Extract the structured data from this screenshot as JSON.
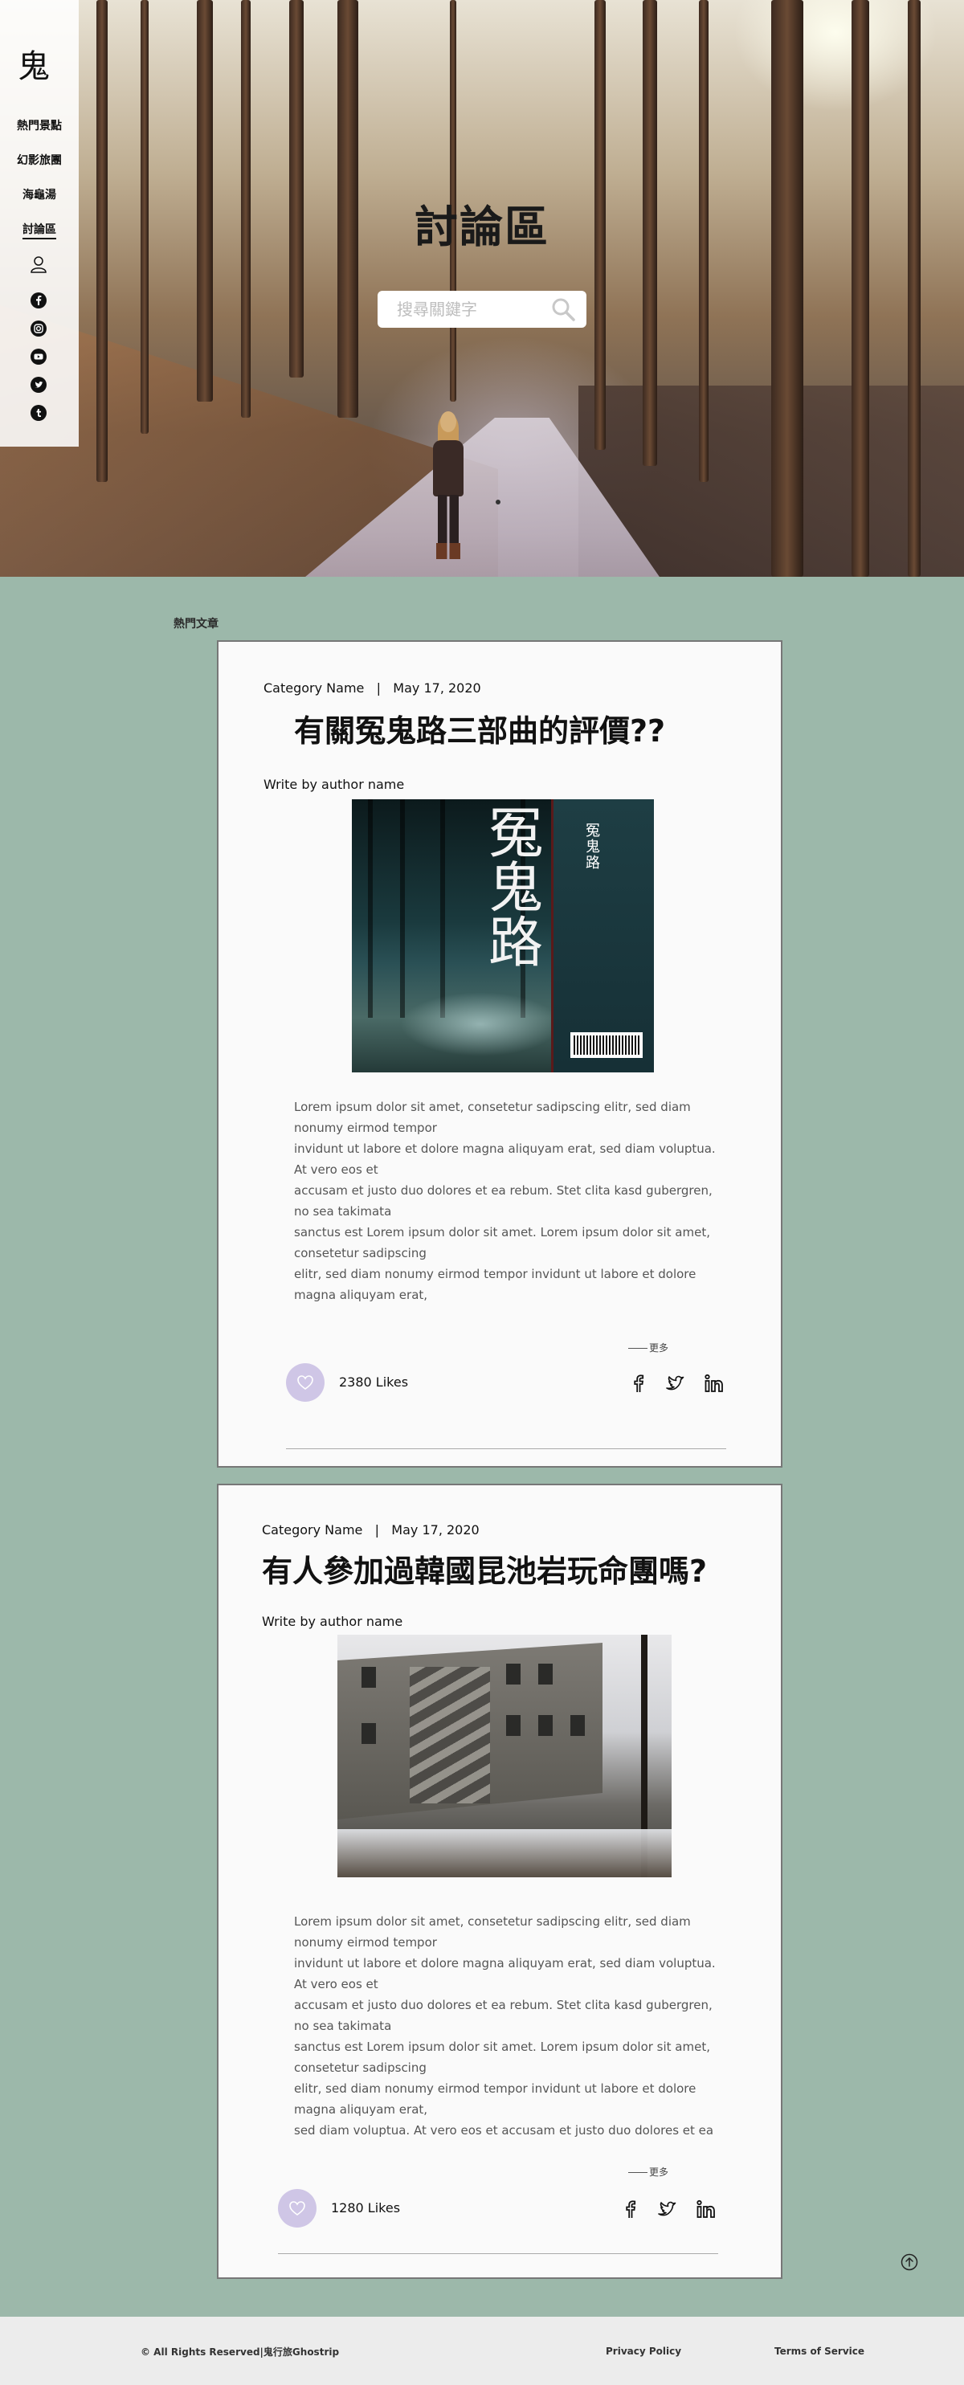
{
  "sidebar": {
    "logo": "鬼",
    "nav": [
      {
        "label": "熱門景點"
      },
      {
        "label": "幻影旅團"
      },
      {
        "label": "海龜湯"
      },
      {
        "label": "討論區",
        "active": true
      }
    ],
    "icons": [
      "user-icon",
      "facebook-icon",
      "instagram-icon",
      "youtube-icon",
      "twitter-icon",
      "tumblr-icon"
    ]
  },
  "hero": {
    "title": "討論區",
    "search_placeholder": "搜尋關鍵字"
  },
  "main": {
    "section_label": "熱門文章",
    "posts": [
      {
        "category": "Category Name",
        "separator": "|",
        "date": "May 17, 2020",
        "title": "有關冤鬼路三部曲的評價??",
        "author": "Write by author name",
        "body": "Lorem ipsum dolor sit amet, consetetur sadipscing elitr, sed diam nonumy eirmod tempor\ninvidunt ut labore et dolore magna aliquyam erat, sed diam voluptua. At vero eos et\naccusam et justo duo dolores et ea rebum. Stet clita kasd gubergren, no sea takimata\nsanctus est Lorem ipsum dolor sit amet. Lorem ipsum dolor sit amet, consetetur sadipscing\nelitr, sed diam nonumy eirmod tempor invidunt ut labore et dolore magna aliquyam erat,",
        "more": "更多",
        "likes": "2380 Likes"
      },
      {
        "category": "Category Name",
        "separator": "|",
        "date": "May 17, 2020",
        "title": "有人參加過韓國昆池岩玩命團嗎?",
        "author": "Write by author name",
        "body": "Lorem ipsum dolor sit amet, consetetur sadipscing elitr, sed diam nonumy eirmod tempor\ninvidunt ut labore et dolore magna aliquyam erat, sed diam voluptua. At vero eos et\naccusam et justo duo dolores et ea rebum. Stet clita kasd gubergren, no sea takimata\nsanctus est Lorem ipsum dolor sit amet. Lorem ipsum dolor sit amet, consetetur sadipscing\nelitr, sed diam nonumy eirmod tempor invidunt ut labore et dolore magna aliquyam erat,\nsed diam voluptua. At vero eos et accusam et justo duo dolores et ea",
        "more": "更多",
        "likes": "1280 Likes"
      }
    ],
    "book_cover": {
      "title": "冤鬼路",
      "spine_title": "冤鬼路"
    }
  },
  "footer": {
    "copyright": "©  All Rights Reserved|鬼行旅Ghostrip",
    "privacy": "Privacy Policy",
    "terms": "Terms of Service"
  },
  "colors": {
    "page_bg": "#9cb8aa",
    "card_bg": "#fafafa",
    "like_bg": "#cfc6e6",
    "footer_bg": "#ececec"
  }
}
